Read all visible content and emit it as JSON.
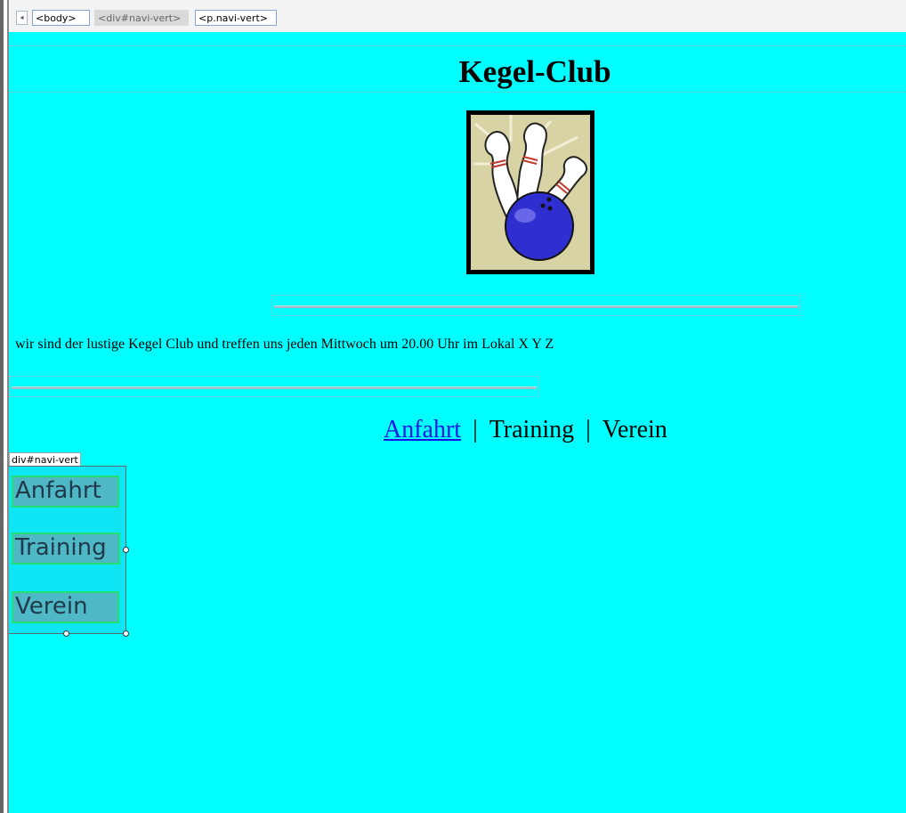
{
  "tag_selector": {
    "scroll_arrow": "◂",
    "tags": [
      "<body>",
      "<div#navi-vert>",
      "<p.navi-vert>"
    ]
  },
  "page": {
    "heading": "Kegel-Club",
    "logo_alt": "Bowling pins and ball",
    "intro": "wir sind der lustige Kegel Club und treffen  uns jeden Mittwoch um 20.00 Uhr im Lokal X Y Z",
    "topnav": {
      "items": [
        "Anfahrt",
        "Training",
        "Verein"
      ],
      "separator": "|"
    }
  },
  "navi_vert": {
    "label": "div#navi-vert",
    "items": [
      "Anfahrt",
      "Training",
      "Verein"
    ]
  },
  "colors": {
    "canvas_bg": "#00ffff",
    "link": "#1a17e6",
    "selection_border": "#20e070"
  }
}
